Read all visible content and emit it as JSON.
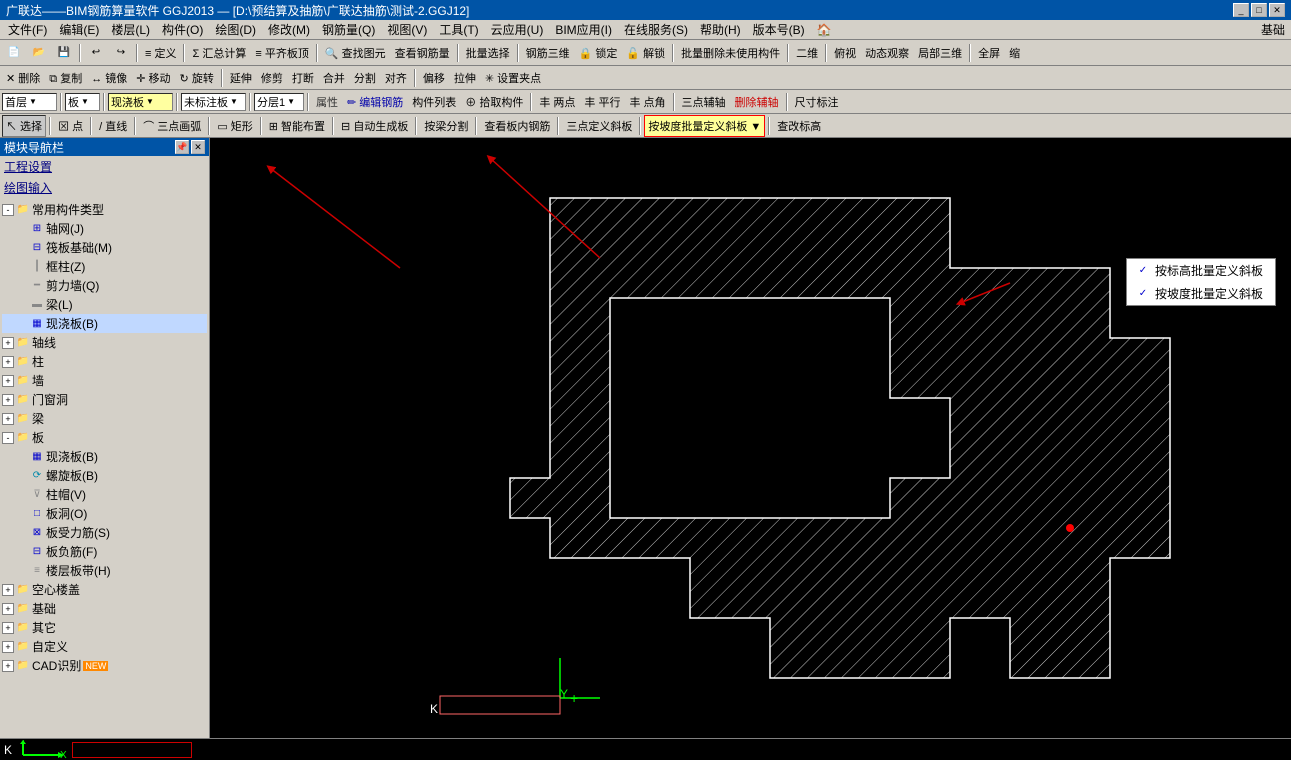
{
  "titleBar": {
    "title": "广联达——BIM钢筋算量软件 GGJ2013 — [D:\\预结算及抽筋\\广联达抽筋\\测试-2.GGJ12]",
    "topRightLabel": "基础"
  },
  "menuBar": {
    "items": [
      "文件(F)",
      "编辑(E)",
      "楼层(L)",
      "构件(O)",
      "绘图(D)",
      "修改(M)",
      "钢筋量(Q)",
      "视图(V)",
      "工具(T)",
      "云应用(U)",
      "BIM应用(I)",
      "在线服务(S)",
      "帮助(H)",
      "版本号(B)"
    ]
  },
  "toolbar1": {
    "buttons": [
      "新建",
      "打开",
      "保存",
      "撤销",
      "恢复",
      "定义",
      "汇总计算",
      "平齐板顶",
      "查找图元",
      "查看钢筋量",
      "批量选择",
      "钢筋三维",
      "锁定",
      "解锁",
      "批量删除未使用构件",
      "二维",
      "俯视",
      "动态观察",
      "局部三维",
      "全屏",
      "缩略"
    ]
  },
  "toolbar2": {
    "buttons": [
      "删除",
      "复制",
      "镜像",
      "移动",
      "旋转",
      "延伸",
      "修剪",
      "打断",
      "合并",
      "分割",
      "对齐",
      "偏移",
      "拉伸",
      "设置夹点"
    ]
  },
  "toolbar3": {
    "floor": "首层",
    "component": "板",
    "view": "现浇板",
    "label": "未标注板",
    "layer": "分层1",
    "buttons": [
      "属性",
      "编辑钢筋",
      "构件列表",
      "拾取构件",
      "丰两点",
      "丰平行",
      "丰点角",
      "三点辅轴",
      "删除辅轴",
      "尺寸标注"
    ]
  },
  "toolbar4": {
    "buttons": [
      "选择",
      "点",
      "直线",
      "三点画弧",
      "矩形",
      "智能布置",
      "自动生成板",
      "按梁分割",
      "查看板内钢筋",
      "三点定义斜板",
      "按坡度批量定义斜板",
      "查改标高"
    ]
  },
  "leftPanel": {
    "header": "模块导航栏",
    "sections": [
      "工程设置",
      "绘图输入"
    ],
    "tree": {
      "items": [
        {
          "label": "常用构件类型",
          "level": 0,
          "toggle": "-",
          "icon": "folder"
        },
        {
          "label": "轴网(J)",
          "level": 1,
          "toggle": "",
          "icon": "grid"
        },
        {
          "label": "筏板基础(M)",
          "level": 1,
          "toggle": "",
          "icon": "grid"
        },
        {
          "label": "框柱(Z)",
          "level": 1,
          "toggle": "",
          "icon": "col"
        },
        {
          "label": "剪力墙(Q)",
          "level": 1,
          "toggle": "",
          "icon": "wall"
        },
        {
          "label": "梁(L)",
          "level": 1,
          "toggle": "",
          "icon": "beam"
        },
        {
          "label": "现浇板(B)",
          "level": 1,
          "toggle": "",
          "icon": "slab",
          "active": true
        },
        {
          "label": "轴线",
          "level": 0,
          "toggle": "+",
          "icon": "folder"
        },
        {
          "label": "柱",
          "level": 0,
          "toggle": "+",
          "icon": "folder"
        },
        {
          "label": "墙",
          "level": 0,
          "toggle": "+",
          "icon": "folder"
        },
        {
          "label": "门窗洞",
          "level": 0,
          "toggle": "+",
          "icon": "folder"
        },
        {
          "label": "梁",
          "level": 0,
          "toggle": "+",
          "icon": "folder"
        },
        {
          "label": "板",
          "level": 0,
          "toggle": "-",
          "icon": "folder"
        },
        {
          "label": "现浇板(B)",
          "level": 1,
          "toggle": "",
          "icon": "slab"
        },
        {
          "label": "螺旋板(B)",
          "level": 1,
          "toggle": "",
          "icon": "spiral"
        },
        {
          "label": "柱帽(V)",
          "level": 1,
          "toggle": "",
          "icon": "cap"
        },
        {
          "label": "板洞(O)",
          "level": 1,
          "toggle": "",
          "icon": "hole"
        },
        {
          "label": "板受力筋(S)",
          "level": 1,
          "toggle": "",
          "icon": "rebar"
        },
        {
          "label": "板负筋(F)",
          "level": 1,
          "toggle": "",
          "icon": "rebar"
        },
        {
          "label": "楼层板带(H)",
          "level": 1,
          "toggle": "",
          "icon": "band"
        },
        {
          "label": "空心楼盖",
          "level": 0,
          "toggle": "+",
          "icon": "folder"
        },
        {
          "label": "基础",
          "level": 0,
          "toggle": "+",
          "icon": "folder"
        },
        {
          "label": "其它",
          "level": 0,
          "toggle": "+",
          "icon": "folder"
        },
        {
          "label": "自定义",
          "level": 0,
          "toggle": "+",
          "icon": "folder"
        },
        {
          "label": "CAD识别",
          "level": 0,
          "toggle": "+",
          "icon": "folder",
          "badge": "NEW"
        }
      ]
    }
  },
  "dropdownMenu": {
    "items": [
      {
        "label": "按标高批量定义斜板"
      },
      {
        "label": "按坡度批量定义斜板"
      }
    ]
  },
  "canvas": {
    "backgroundColor": "#000000"
  },
  "statusBar": {
    "coord": "K",
    "xLabel": "X:",
    "yLabel": "Y:"
  }
}
